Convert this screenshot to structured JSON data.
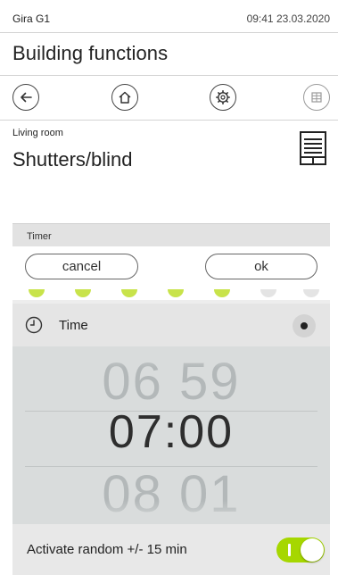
{
  "status_bar": {
    "brand": "Gira G1",
    "clock": "09:41 23.03.2020"
  },
  "header": {
    "title": "Building functions"
  },
  "nav": {
    "buttons": [
      {
        "name": "back",
        "icon": "arrow-left-icon"
      },
      {
        "name": "home",
        "icon": "house-icon"
      },
      {
        "name": "functions",
        "icon": "gear-icon"
      },
      {
        "name": "grid",
        "icon": "grid-icon"
      }
    ]
  },
  "function": {
    "room": "Living room",
    "title": "Shutters/blind",
    "icon": "blind-icon"
  },
  "timer": {
    "header": "Timer",
    "cancel_label": "cancel",
    "ok_label": "ok",
    "time_row": {
      "label": "Time",
      "icon": "clock-icon",
      "selected": true
    },
    "picker": {
      "previous": "06 59",
      "current": "07:00",
      "next": "08 01"
    },
    "random": {
      "label": "Activate random +/- 15 min",
      "enabled": true
    }
  },
  "colors": {
    "accent": "#a6d700",
    "panel": "#ededed",
    "picker_bg": "#d9dcdc"
  }
}
